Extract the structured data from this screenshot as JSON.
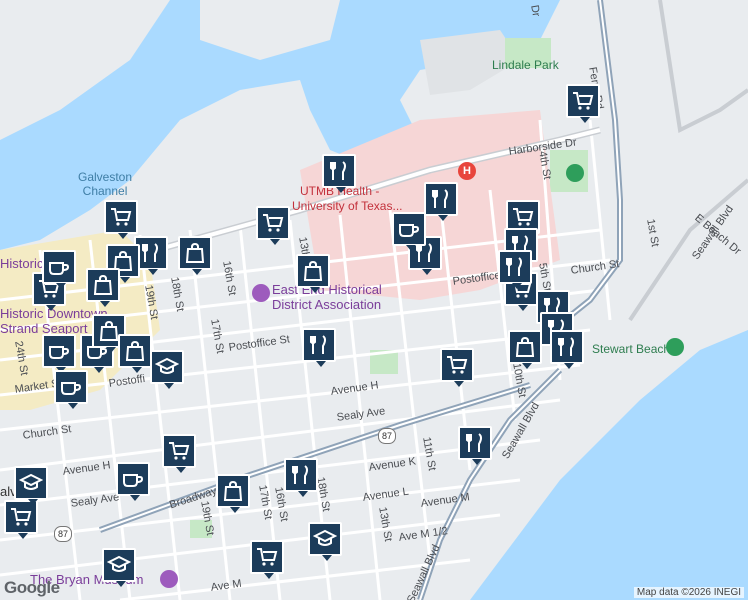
{
  "map": {
    "labels": {
      "galveston_channel": "Galveston\nChannel",
      "lindale_park": "Lindale Park",
      "harborside_dr": "Harborside Dr",
      "utmb": "UTMB Health -\nUniversity of Texas...",
      "east_end": "East End Historical\nDistrict Association",
      "historic_downtown": "Historic Downtown\nStrand Seaport",
      "stewart_beach": "Stewart Beach",
      "bryan_museum": "The Bryan Museum",
      "ferry_rd": "Ferry Rd",
      "seawall_blvd_right": "Seawall Blvd",
      "seawall_blvd_bottom": "Seawall Blvd",
      "seawall_blvd_mid": "Seawall Blvd",
      "broadway": "Broadway Ave J",
      "postoffice_left": "Postoffice St",
      "postoffice_right": "Postoffice St",
      "postoffice_far_left": "Postoffi",
      "church_right": "Church St",
      "church_left": "Church St",
      "market": "Market St",
      "avenue_h": "Avenue H",
      "avenue_h_left": "Avenue H",
      "sealy_ave": "Sealy Ave",
      "sealy_ave_left": "Sealy Ave",
      "avenue_k": "Avenue K",
      "avenue_l": "Avenue L",
      "avenue_m": "Avenue M",
      "avenue_m_half": "Ave M 1/2",
      "ave_m": "Ave M",
      "e_beach_dr": "E Beach Dr",
      "st_16": "16th St",
      "st_17": "17th St",
      "st_18": "18th St",
      "st_19": "19th St",
      "st_24": "24th St",
      "st_13": "13th St",
      "st_13_bottom": "13th St",
      "st_11": "11th St",
      "st_10": "10th St",
      "st_5": "5th St",
      "st_4": "4th St",
      "st_1": "1st St",
      "st_16_bottom": "16th St",
      "st_17_bottom": "17th St",
      "st_19_bottom": "19th St",
      "st_18_bottom": "18th St",
      "galveston_left": "alveston",
      "dr_top": "Dr"
    },
    "shields": [
      "87",
      "87"
    ],
    "colors": {
      "water": "#aadaff",
      "land": "#e9ecef",
      "park": "#c6e8c6",
      "hospital": "#f6d6d6",
      "downtown": "#f4ebc4",
      "road": "#ffffff",
      "highway": "#8fa3b8",
      "pin": "#1c3c5a"
    },
    "markers": [
      {
        "type": "cart",
        "name": "shopping"
      },
      {
        "type": "utensils",
        "name": "restaurant"
      },
      {
        "type": "coffee",
        "name": "cafe"
      },
      {
        "type": "bag",
        "name": "store"
      },
      {
        "type": "cap",
        "name": "school"
      }
    ],
    "attribution": "Map data ©2026 INEGI",
    "google_logo": "Google"
  }
}
